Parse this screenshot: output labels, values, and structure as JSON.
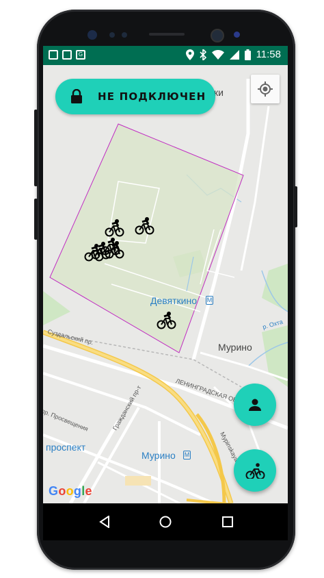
{
  "status_bar": {
    "time": "11:58",
    "icons": [
      "notification-icon",
      "image-icon",
      "translate-icon",
      "location-icon",
      "bluetooth-icon",
      "wifi-icon",
      "signal-icon",
      "battery-icon"
    ]
  },
  "lock_status": {
    "label": "НЕ ПОДКЛЮЧЕН",
    "icon": "lock-icon",
    "color": "#1fd0b8"
  },
  "map": {
    "labels": {
      "partial_ki": "ки",
      "devyatkino": "Девяткино",
      "murino_town": "Мурино",
      "murino_metro": "Мурино",
      "prospekt": "проспект",
      "suzdalsky": "Суздальский пр.",
      "prosvescheniya": "пр. Просвещения",
      "grazhdansky": "Гражданский пр-т",
      "leningradskaya": "ЛЕНИНГРАДСКАЯ ОБЛ.",
      "okhta": "р. Охта",
      "murinskaya_doroga": "Мурinskaya дор."
    },
    "zone_color": "#c02bc2",
    "attribution": "Google",
    "bikes_in_zone": 6,
    "bikes_outside": 1
  },
  "buttons": {
    "my_location": "my-location-icon",
    "profile": "person-icon",
    "bikes": "bicycle-icon"
  },
  "nav_bar": {
    "back": "back-icon",
    "home": "home-icon",
    "recents": "recents-icon"
  }
}
